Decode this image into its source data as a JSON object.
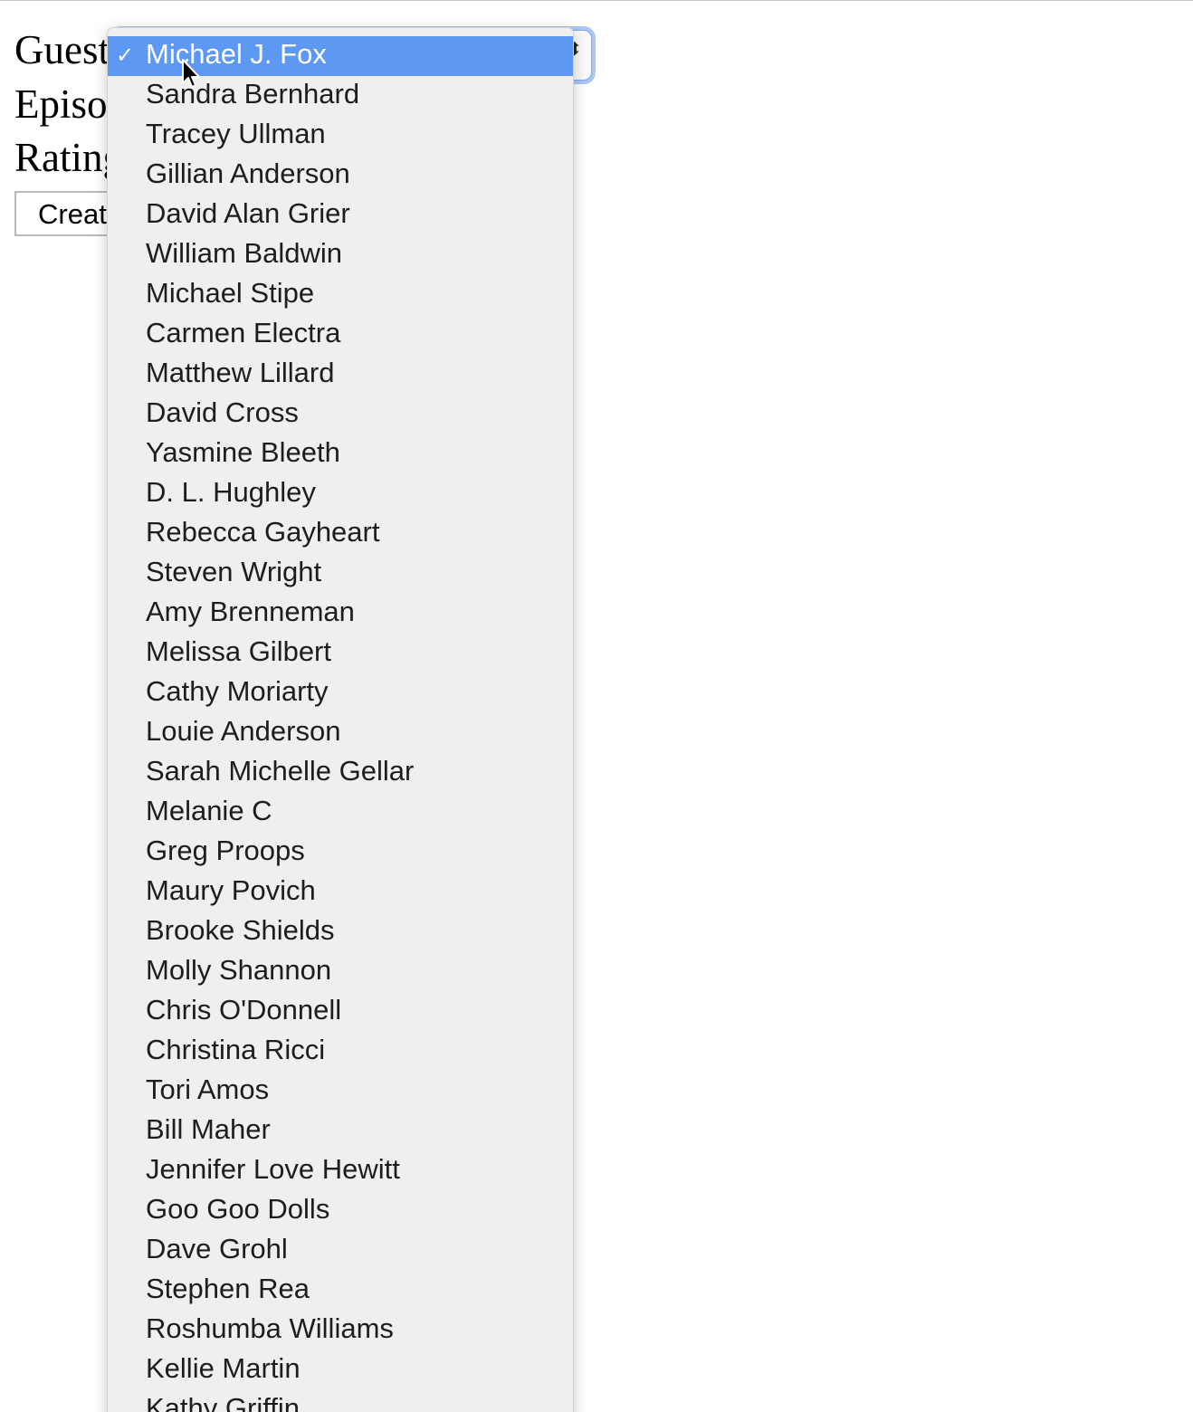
{
  "form": {
    "guest_label": "Guest",
    "episode_label": "Episode",
    "rating_label": "Rating",
    "create_button_label": "Create"
  },
  "dropdown": {
    "selected_index": 0,
    "options": [
      "Michael J. Fox",
      "Sandra Bernhard",
      "Tracey Ullman",
      "Gillian Anderson",
      "David Alan Grier",
      "William Baldwin",
      "Michael Stipe",
      "Carmen Electra",
      "Matthew Lillard",
      "David Cross",
      "Yasmine Bleeth",
      "D. L. Hughley",
      "Rebecca Gayheart",
      "Steven Wright",
      "Amy Brenneman",
      "Melissa Gilbert",
      "Cathy Moriarty",
      "Louie Anderson",
      "Sarah Michelle Gellar",
      "Melanie C",
      "Greg Proops",
      "Maury Povich",
      "Brooke Shields",
      "Molly Shannon",
      "Chris O'Donnell",
      "Christina Ricci",
      "Tori Amos",
      "Bill Maher",
      "Jennifer Love Hewitt",
      "Goo Goo Dolls",
      "Dave Grohl",
      "Stephen Rea",
      "Roshumba Williams",
      "Kellie Martin",
      "Kathy Griffin"
    ]
  },
  "colors": {
    "selection": "#5d99f3",
    "menu_background": "#efefef",
    "focus_ring": "#a9c8f6"
  }
}
